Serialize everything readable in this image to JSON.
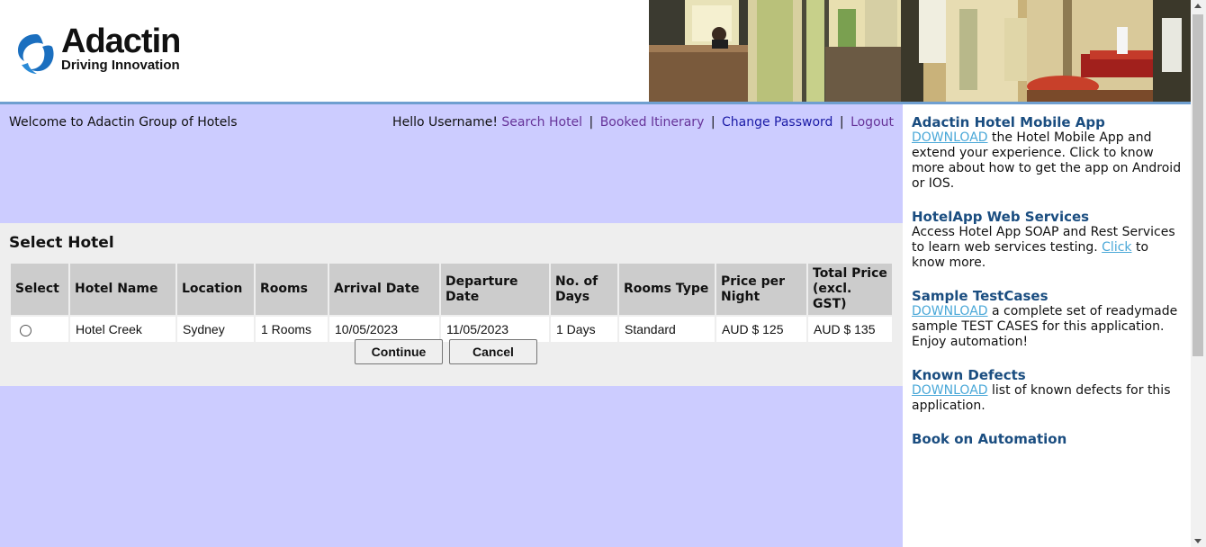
{
  "brand": {
    "name": "Adactin",
    "tagline": "Driving Innovation"
  },
  "header": {
    "welcome": "Welcome to Adactin Group of Hotels",
    "greeting": "Hello Username!",
    "nav": {
      "search_hotel": "Search Hotel",
      "booked_itinerary": "Booked Itinerary",
      "change_password": "Change Password",
      "logout": "Logout",
      "separator": "|"
    }
  },
  "select_hotel": {
    "title": "Select Hotel",
    "columns": {
      "select": "Select",
      "hotel_name": "Hotel Name",
      "location": "Location",
      "rooms": "Rooms",
      "arrival_date": "Arrival Date",
      "departure_date": "Departure Date",
      "no_of_days": "No. of Days",
      "rooms_type": "Rooms Type",
      "price_per_night": "Price per Night",
      "total_price": "Total Price (excl. GST)"
    },
    "rows": [
      {
        "hotel_name": "Hotel Creek",
        "location": "Sydney",
        "rooms": "1 Rooms",
        "arrival_date": "10/05/2023",
        "departure_date": "11/05/2023",
        "no_of_days": "1 Days",
        "rooms_type": "Standard",
        "price_per_night": "AUD $ 125",
        "total_price": "AUD $ 135"
      }
    ],
    "continue_label": "Continue",
    "cancel_label": "Cancel"
  },
  "sidebar": {
    "mobile_app": {
      "title": "Adactin Hotel Mobile App",
      "link": "DOWNLOAD",
      "text": " the Hotel Mobile App and extend your experience. Click to know more about how to get the app on Android or IOS."
    },
    "web_services": {
      "title": "HotelApp Web Services",
      "text_before": "Access Hotel App SOAP and Rest Services to learn web services testing. ",
      "link": "Click",
      "text_after": " to know more."
    },
    "test_cases": {
      "title": "Sample TestCases",
      "link": "DOWNLOAD",
      "text": " a complete set of readymade sample TEST CASES for this application. Enjoy automation!"
    },
    "known_defects": {
      "title": "Known Defects",
      "link": "DOWNLOAD",
      "text": " list of known defects for this application."
    },
    "book": {
      "title": "Book on Automation"
    }
  },
  "colors": {
    "content_bg": "#ccccff",
    "panel_bg": "#eeeeee",
    "table_header_bg": "#cccccc",
    "sidebar_title": "#1a4d80",
    "download_link": "#4aa8d8",
    "visited_link": "#663399",
    "nav_link": "#1a1aa6"
  },
  "icons": {
    "logo": "adactin-swirl-logo",
    "banner": "hotel-lobby-photo"
  }
}
